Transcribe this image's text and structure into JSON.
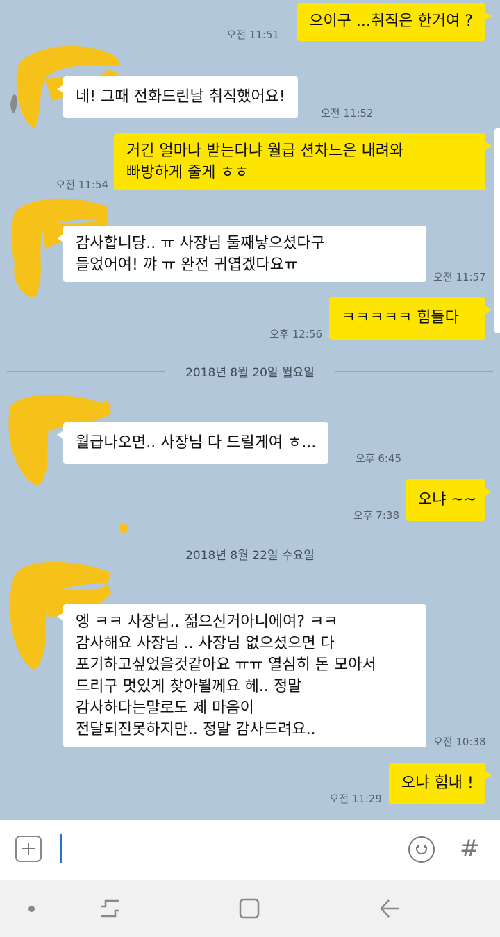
{
  "messages": [
    {
      "side": "me",
      "lines": [
        "으이구 ...취직은 한거여 ?"
      ],
      "time": "오전 11:51"
    },
    {
      "side": "other",
      "lines": [
        "네! 그때 전화드린날 취직했어요!"
      ],
      "time": "오전 11:52"
    },
    {
      "side": "me",
      "lines": [
        "거긴 얼마나 받는다냐 월급 션차느은 내려와",
        "빠방하게 줄게 ㅎㅎ"
      ],
      "time": "오전 11:54"
    },
    {
      "side": "other",
      "lines": [
        "감사합니당.. ㅠ 사장님 둘째낳으셨다구",
        "들었어여! 꺄 ㅠ 완전 귀엽겠다요ㅠ"
      ],
      "time": "오전 11:57"
    },
    {
      "side": "me",
      "lines": [
        "ㅋㅋㅋㅋㅋ  힘들다"
      ],
      "time": "오후 12:56"
    },
    {
      "side": "other",
      "lines": [
        "월급나오면.. 사장님 다 드릴게여 ㅎ..."
      ],
      "time": "오후 6:45"
    },
    {
      "side": "me",
      "lines": [
        "오냐 ~~"
      ],
      "time": "오후 7:38"
    },
    {
      "side": "other",
      "lines": [
        "엥 ㅋㅋ 사장님.. 젊으신거아니에여? ㅋㅋ",
        "감사해요 사장님 .. 사장님 없으셨으면 다",
        "포기하고싶었을것같아요 ㅠㅠ 열심히 돈 모아서",
        "드리구 멋있게 찾아뵐께요 헤.. 정말",
        "감사하다는말로도 제 마음이",
        "전달되진못하지만.. 정말 감사드려요.."
      ],
      "time": "오전 10:38"
    },
    {
      "side": "me",
      "lines": [
        "오냐 힘내 !"
      ],
      "time": "오전 11:29"
    }
  ],
  "date_separators": [
    "2018년 8월 20일 월요일",
    "2018년 8월 22일 수요일"
  ],
  "input_bar": {
    "icons": [
      "plus-icon",
      "emoji-icon",
      "hashtag-icon"
    ],
    "hash_glyph": "#"
  },
  "nav_bar": {
    "icons": [
      "dot-icon",
      "recent-apps-icon",
      "home-icon",
      "back-icon"
    ]
  },
  "colors": {
    "background": "#b2c7d9",
    "my_bubble": "#fee500",
    "their_bubble": "#ffffff",
    "avatar_scribble": "#f6c21a"
  }
}
